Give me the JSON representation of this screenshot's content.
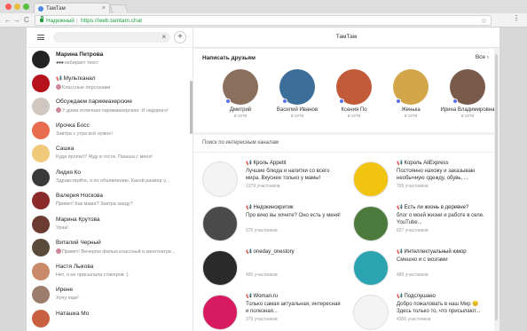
{
  "browser": {
    "tab_title": "ТамТам",
    "tab_close": "×",
    "secure_label": "Надежный",
    "separator": "|",
    "url": "https://web.tamtam.chat",
    "back": "←",
    "forward": "→",
    "reload": "C",
    "star": "☆",
    "menu": "⋮"
  },
  "sidebar": {
    "search_clear": "×",
    "add": "+",
    "chats": [
      {
        "name": "Марина Петрова",
        "message": "набирает текст",
        "typing": true,
        "bold": true,
        "color": "#222222"
      },
      {
        "name": "Мультканал",
        "message": "Классные персонажи",
        "channel": true,
        "mini": true,
        "color": "#b5121b"
      },
      {
        "name": "Обсуждаем парикмахерские",
        "message": "У дома отличная парикмахерская. И недорого!",
        "mini": true,
        "color": "#d0c8c0"
      },
      {
        "name": "Ирочка Босс",
        "message": "Завтра с утра всё нужно!",
        "color": "#e86c4f"
      },
      {
        "name": "Сашка",
        "message": "Куда пропал? Жду в гости. Пишша с меня!",
        "color": "#f0c97a"
      },
      {
        "name": "Лидия Ко",
        "message": "Здравствуйте, я по объявлению. Какой размер у...",
        "color": "#3a3a3a"
      },
      {
        "name": "Валерия Носкова",
        "message": "Привет! Как мама? Завтра заеду?",
        "color": "#8a2a2a"
      },
      {
        "name": "Марина Крутова",
        "message": "Ураа!",
        "color": "#6b3c2f"
      },
      {
        "name": "Виталий Черный",
        "message": "Привет! Вечером фильм классный в кинотеатре...",
        "mini": true,
        "color": "#5a4a3a"
      },
      {
        "name": "Настя Лыкова",
        "message": "Нет, я не присылала стикеров :)",
        "color": "#c98a6a"
      },
      {
        "name": "Ирене",
        "message": "Хочу еще!",
        "color": "#9c7c6c"
      },
      {
        "name": "Наташка Мо",
        "message": "",
        "color": "#c86040"
      }
    ]
  },
  "main": {
    "title": "ТамТам",
    "friends_title": "Написать друзьям",
    "all_label": "Все",
    "all_icon": "›",
    "friends": [
      {
        "name": "Дмитрий",
        "status": "в сети",
        "color": "#8a6f5c"
      },
      {
        "name": "Василий Иванов",
        "status": "в сети",
        "color": "#3c6e9a"
      },
      {
        "name": "Ксения По",
        "status": "в сети",
        "color": "#c25a3a"
      },
      {
        "name": "Женька",
        "status": "в сети",
        "color": "#d4a64a"
      },
      {
        "name": "Ирина Владимировна",
        "status": "в сети",
        "color": "#7a5a4a"
      }
    ],
    "channels_title": "Поиск по интересным каналам",
    "channels": [
      {
        "name": "Кроль Appetit",
        "desc": "Лучшие блюда и напитки со всего мира. Вкуснее только у мамы!",
        "members": "1379 участников",
        "color": "#f4f4f4"
      },
      {
        "name": "Король AliExpress",
        "desc": "Постоянно нахожу и заказываю необычную одежду, обувь, ...",
        "members": "765 участников",
        "color": "#f1c40f"
      },
      {
        "name": "Недокинокритик",
        "desc": "Про кино вы хочете? Оно есть у меня!",
        "members": "576 участников",
        "color": "#4a4a4a"
      },
      {
        "name": "Есть ли жизнь в деревне?",
        "desc": "блог о моей жизни и работе в селе. YouTube...",
        "members": "827 участников",
        "color": "#4c7a3c"
      },
      {
        "name": "oneday_onestory",
        "desc": "",
        "members": "400 участников",
        "color": "#2a2a2a"
      },
      {
        "name": "Интеллектуальный юмор",
        "desc": "Смешно и с мозгами",
        "members": "489 участников",
        "color": "#2aa4b0"
      },
      {
        "name": "Woman.ru",
        "desc": "Только самая актуальная, интересная и полезная...",
        "members": "379 участников",
        "color": "#d81b60"
      },
      {
        "name": "Подслушано",
        "desc": "Добро пожаловать в наш Мир 😊 Здесь только то, что присылают...",
        "members": "4306 участников",
        "color": "#f4f4f4"
      }
    ]
  },
  "icons": {
    "megaphone": "📢",
    "online_dot_color": "#5a6ff0"
  }
}
